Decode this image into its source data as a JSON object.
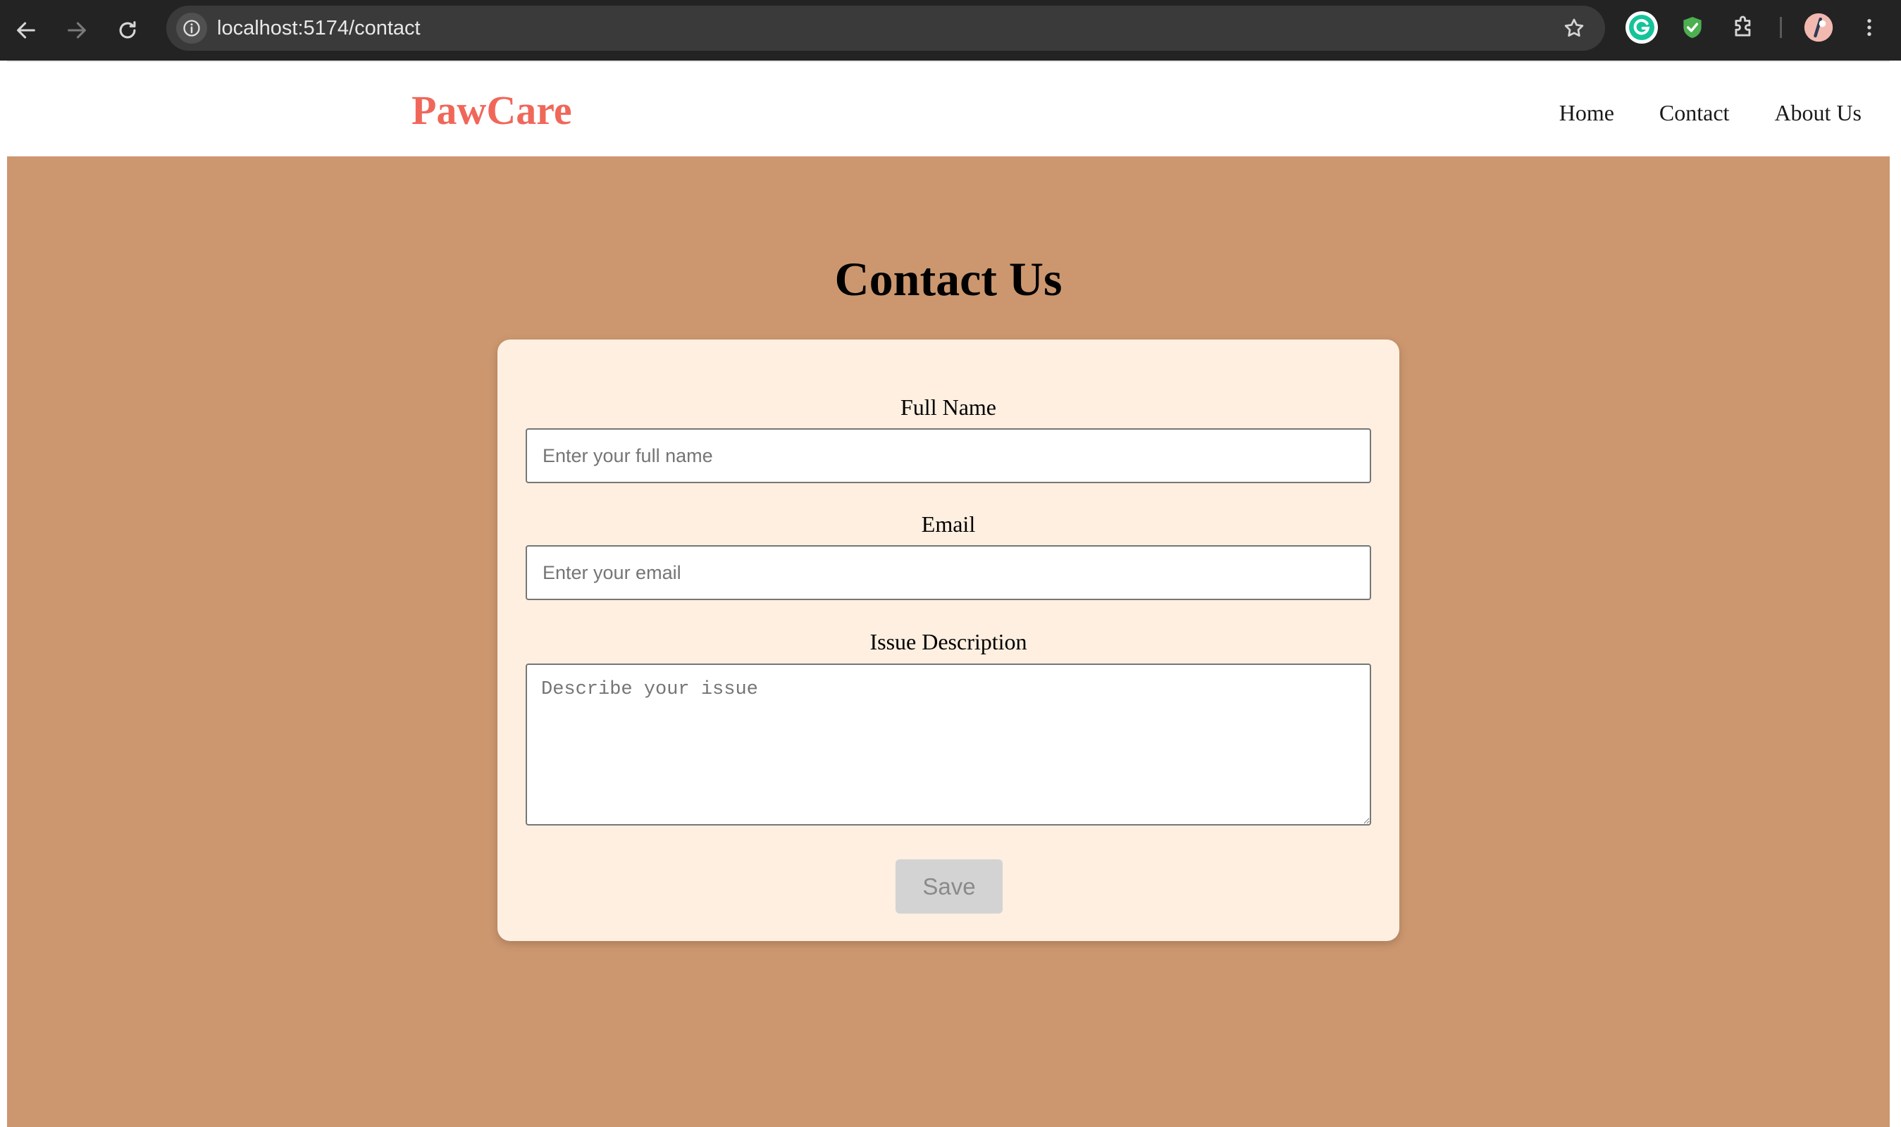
{
  "browser": {
    "url": "localhost:5174/contact",
    "icons": {
      "back": "arrow-left-icon",
      "forward": "arrow-right-icon",
      "reload": "reload-icon",
      "site_info": "info-icon",
      "bookmark": "star-icon",
      "grammarly": "grammarly-icon",
      "shield": "shield-check-icon",
      "extensions": "puzzle-icon",
      "profile": "avatar",
      "menu": "kebab-menu-icon"
    }
  },
  "header": {
    "logo": "PawCare",
    "nav": {
      "home": "Home",
      "contact": "Contact",
      "about": "About Us"
    }
  },
  "main": {
    "title": "Contact Us",
    "form": {
      "full_name": {
        "label": "Full Name",
        "value": "",
        "placeholder": "Enter your full name"
      },
      "email": {
        "label": "Email",
        "value": "",
        "placeholder": "Enter your email"
      },
      "issue": {
        "label": "Issue Description",
        "value": "",
        "placeholder": "Describe your issue"
      },
      "save_label": "Save"
    }
  },
  "colors": {
    "brand": "#f0675a",
    "background": "#cc976f",
    "card": "#feefe0",
    "button_disabled": "#d3d3d3"
  }
}
